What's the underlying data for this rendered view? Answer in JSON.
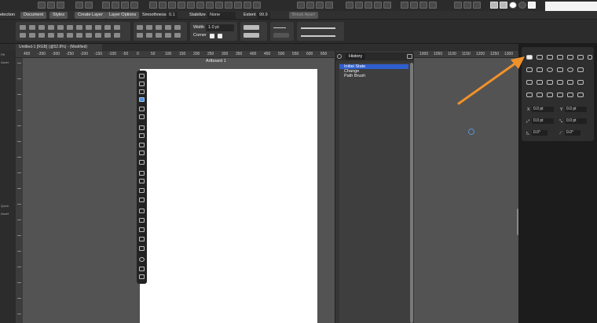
{
  "top_context_bar": {
    "selection_label": "election",
    "document_button": "Document",
    "styles_button": "Styles",
    "create_layer_button": "Create Layer",
    "layer_options_button": "Layer Options",
    "smoothness_label": "Smoothness",
    "smoothness_value": "0.1",
    "stabilize_label": "Stabilize",
    "stabilize_value": "None",
    "extent_label": "Extent",
    "extent_value": "99.9",
    "break_apart_button": "Break Apart"
  },
  "stroke_toolbar": {
    "width_label": "Width",
    "width_value": "1.0 pt",
    "corner_label": "Corner"
  },
  "document_tab": {
    "title": "Untitled-1 [RGB] (@52.8%) - (Modified)"
  },
  "ruler": {
    "ticks": [
      "400",
      "-350",
      "-300",
      "-250",
      "-200",
      "-150",
      "-100",
      "-50",
      "0",
      "50",
      "100",
      "150",
      "200",
      "250",
      "300",
      "350",
      "400",
      "450",
      "500",
      "550",
      "600",
      "650",
      "700",
      "750",
      "800",
      "850",
      "900",
      "950",
      "1000",
      "1050",
      "1100",
      "1150",
      "1200",
      "1250",
      "1300",
      "1350"
    ]
  },
  "canvas": {
    "artboard_label": "Artboard 1"
  },
  "left_dock": {
    "labels": [
      "Fill",
      "Asset",
      "Quick",
      "Asset"
    ]
  },
  "history_panel": {
    "tab_label": "History",
    "items": [
      {
        "label": "Initial State",
        "selected": true
      },
      {
        "label": "Change",
        "selected": false
      },
      {
        "label": "Path Brush",
        "selected": false
      }
    ]
  },
  "transform_panel": {
    "x_label": "X",
    "x_value": "0.0 pt",
    "y_label": "Y",
    "y_value": "0.0 pt",
    "w_value": "0.0 pt",
    "h_value": "0.0 pt",
    "rotate_value": "0.0°",
    "shear_value": "0.0°"
  },
  "colors": {
    "selection_blue": "#2f5fcf",
    "annotation_arrow": "#f0922a",
    "artboard": "#ffffff"
  }
}
